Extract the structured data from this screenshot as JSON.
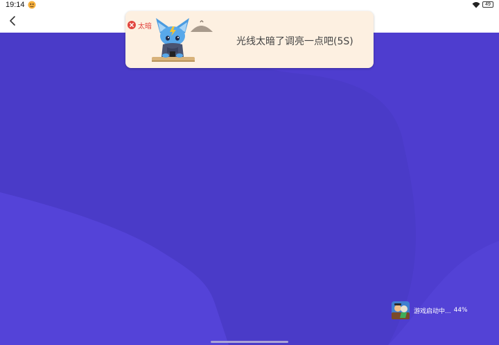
{
  "status_bar": {
    "time": "19:14",
    "battery_level": "49",
    "icons": [
      "app-notification-icon",
      "wifi-icon",
      "battery-icon"
    ]
  },
  "app_bar": {
    "back_icon": "chevron-left-icon"
  },
  "toast": {
    "badge_label": "太暗",
    "badge_icon": "close-circle-icon",
    "message": "光线太暗了调亮一点吧(5S)",
    "illustration": "mascot-with-lamp"
  },
  "game_launch": {
    "label": "游戏启动中...",
    "progress": "44%",
    "icon": "game-thumbnail-icon"
  },
  "colors": {
    "background": "#4a3bc8",
    "background_shape": "#5240d6",
    "background_shade": "#4334b8",
    "toast_bg": "#fdf0e1",
    "badge_red": "#e2453f"
  }
}
